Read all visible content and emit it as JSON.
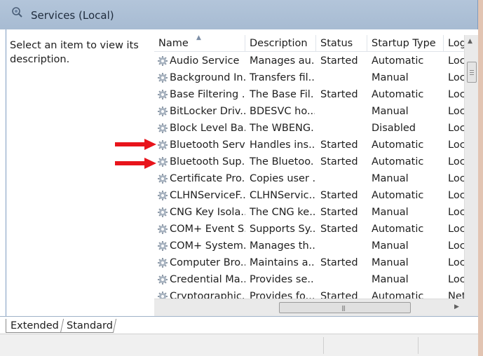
{
  "window": {
    "title": "Services (Local)"
  },
  "left_pane": {
    "description_prompt": "Select an item to view its description."
  },
  "columns": [
    {
      "key": "name",
      "label": "Name",
      "sorted": "ascending"
    },
    {
      "key": "description",
      "label": "Description"
    },
    {
      "key": "status",
      "label": "Status"
    },
    {
      "key": "startup_type",
      "label": "Startup Type"
    },
    {
      "key": "log_on_as",
      "label": "Log"
    }
  ],
  "services": [
    {
      "name": "Audio Service",
      "description": "Manages au...",
      "status": "Started",
      "startup_type": "Automatic",
      "log_on_as": "Loc"
    },
    {
      "name": "Background In...",
      "description": "Transfers fil...",
      "status": "",
      "startup_type": "Manual",
      "log_on_as": "Loc"
    },
    {
      "name": "Base Filtering ...",
      "description": "The Base Fil...",
      "status": "Started",
      "startup_type": "Automatic",
      "log_on_as": "Loc"
    },
    {
      "name": "BitLocker Driv...",
      "description": "BDESVC ho...",
      "status": "",
      "startup_type": "Manual",
      "log_on_as": "Loc"
    },
    {
      "name": "Block Level Ba...",
      "description": "The WBENG...",
      "status": "",
      "startup_type": "Disabled",
      "log_on_as": "Loc"
    },
    {
      "name": "Bluetooth Serv...",
      "description": "Handles ins...",
      "status": "Started",
      "startup_type": "Automatic",
      "log_on_as": "Loc",
      "highlighted_by_arrow": true
    },
    {
      "name": "Bluetooth Sup...",
      "description": "The Bluetoo...",
      "status": "Started",
      "startup_type": "Automatic",
      "log_on_as": "Loc",
      "highlighted_by_arrow": true
    },
    {
      "name": "Certificate Pro...",
      "description": "Copies user ...",
      "status": "",
      "startup_type": "Manual",
      "log_on_as": "Loc"
    },
    {
      "name": "CLHNServiceF...",
      "description": "CLHNServic...",
      "status": "Started",
      "startup_type": "Automatic",
      "log_on_as": "Loc"
    },
    {
      "name": "CNG Key Isola...",
      "description": "The CNG ke...",
      "status": "Started",
      "startup_type": "Manual",
      "log_on_as": "Loc"
    },
    {
      "name": "COM+ Event S...",
      "description": "Supports Sy...",
      "status": "Started",
      "startup_type": "Automatic",
      "log_on_as": "Loc"
    },
    {
      "name": "COM+ System...",
      "description": "Manages th...",
      "status": "",
      "startup_type": "Manual",
      "log_on_as": "Loc"
    },
    {
      "name": "Computer Bro...",
      "description": "Maintains a...",
      "status": "Started",
      "startup_type": "Manual",
      "log_on_as": "Loc"
    },
    {
      "name": "Credential Ma...",
      "description": "Provides se...",
      "status": "",
      "startup_type": "Manual",
      "log_on_as": "Loc"
    },
    {
      "name": "Cryptographic...",
      "description": "Provides fo...",
      "status": "Started",
      "startup_type": "Automatic",
      "log_on_as": "Net"
    }
  ],
  "tabs": [
    {
      "label": "Extended",
      "active": true
    },
    {
      "label": "Standard",
      "active": false
    }
  ],
  "icons": {
    "title": "services-gear-icon",
    "service_row": "gear-icon",
    "annotation": "red-arrow-icon"
  },
  "colors": {
    "header_bg": "#a7bbd2",
    "annotation_arrow": "#e8141b"
  }
}
